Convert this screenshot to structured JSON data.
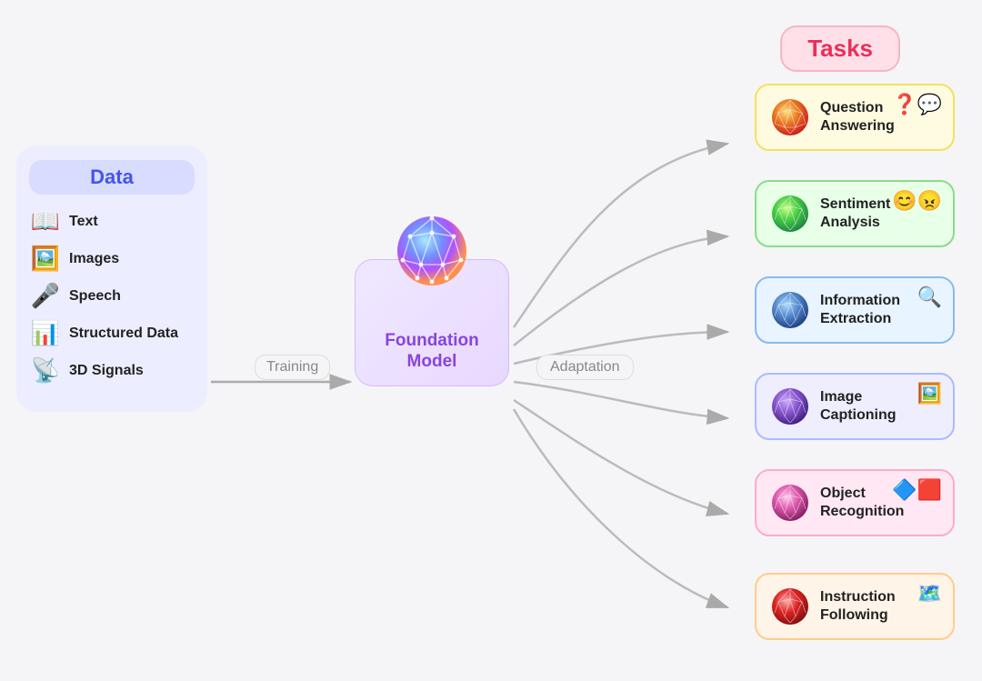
{
  "tasks_title": "Tasks",
  "data_section": {
    "title": "Data",
    "items": [
      {
        "label": "Text",
        "icon": "📖"
      },
      {
        "label": "Images",
        "icon": "🖼️"
      },
      {
        "label": "Speech",
        "icon": "🎤"
      },
      {
        "label": "Structured Data",
        "icon": "📊"
      },
      {
        "label": "3D Signals",
        "icon": "📡"
      }
    ]
  },
  "foundation_model": {
    "title": "Foundation\nModel"
  },
  "labels": {
    "training": "Training",
    "adaptation": "Adaptation"
  },
  "tasks": [
    {
      "label": "Question Answering",
      "bg": "#fffbe0",
      "border": "#f5e060",
      "icon": "❓💬",
      "sphere_color": "#e8a030"
    },
    {
      "label": "Sentiment Analysis",
      "bg": "#e8ffe8",
      "border": "#88dd88",
      "icon": "😊😠",
      "sphere_color": "#66cc44"
    },
    {
      "label": "Information Extraction",
      "bg": "#e8f4ff",
      "border": "#88bbee",
      "icon": "🔍",
      "sphere_color": "#5588cc"
    },
    {
      "label": "Image Captioning",
      "bg": "#e8f0ff",
      "border": "#aabbff",
      "icon": "🖼️",
      "sphere_color": "#8866dd"
    },
    {
      "label": "Object Recognition",
      "bg": "#ffe8f4",
      "border": "#ffaacc",
      "icon": "🔷🟥",
      "sphere_color": "#dd66aa"
    },
    {
      "label": "Instruction Following",
      "bg": "#fff4e8",
      "border": "#ffcc88",
      "icon": "🗺️",
      "sphere_color": "#dd4444"
    }
  ]
}
